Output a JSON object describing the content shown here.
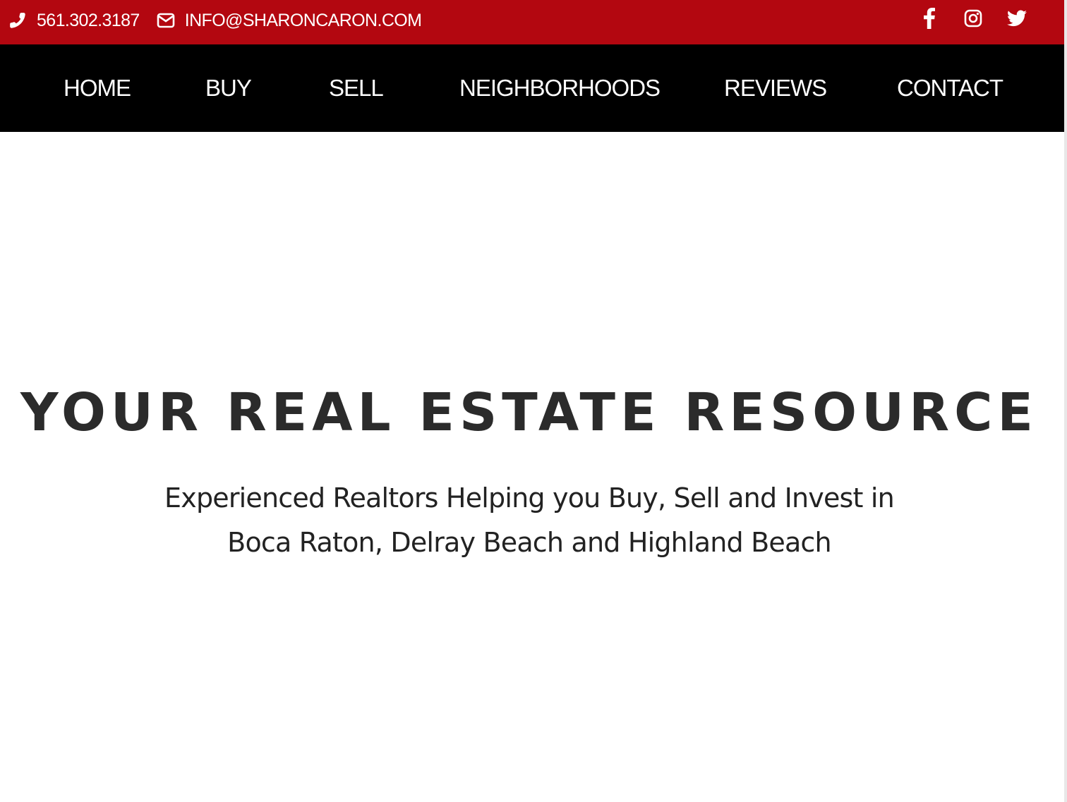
{
  "topbar": {
    "background": "#b30710",
    "phone": "561.302.3187",
    "email": "INFO@SHARONCARON.COM",
    "phone_icon": "phone-icon",
    "email_icon": "envelope-icon",
    "social": [
      {
        "name": "facebook",
        "icon": "facebook-icon"
      },
      {
        "name": "instagram",
        "icon": "instagram-icon"
      },
      {
        "name": "twitter",
        "icon": "twitter-icon"
      }
    ]
  },
  "nav": {
    "background": "#000000",
    "items": [
      {
        "label": "HOME"
      },
      {
        "label": "BUY"
      },
      {
        "label": "SELL"
      },
      {
        "label": "NEIGHBORHOODS"
      },
      {
        "label": "REVIEWS"
      },
      {
        "label": "CONTACT"
      }
    ]
  },
  "hero": {
    "title": "YOUR REAL ESTATE RESOURCE",
    "subtitle_line1": "Experienced Realtors Helping you Buy, Sell and Invest in",
    "subtitle_line2": "Boca Raton, Delray Beach and Highland Beach",
    "text_color": "#2b2b2b"
  }
}
